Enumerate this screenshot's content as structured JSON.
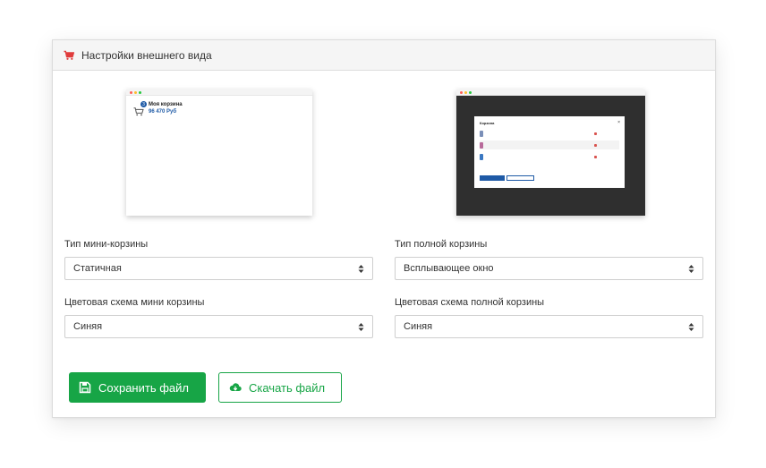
{
  "colors": {
    "accent_green": "#17a546",
    "brand_blue": "#1e5aa6",
    "header_icon_red": "#e03b3b"
  },
  "header": {
    "icon": "shopping-cart-icon",
    "title": "Настройки внешнего вида"
  },
  "preview_mini": {
    "cart_title": "Моя корзина",
    "cart_sum": "96 470 Руб",
    "badge": "3"
  },
  "preview_full": {
    "modal_title": "Корзина",
    "close": "×"
  },
  "form": {
    "mini_type": {
      "label": "Тип мини-корзины",
      "value": "Статичная"
    },
    "full_type": {
      "label": "Тип полной корзины",
      "value": "Всплывающее окно"
    },
    "mini_color": {
      "label": "Цветовая схема мини корзины",
      "value": "Синяя"
    },
    "full_color": {
      "label": "Цветовая схема полной корзины",
      "value": "Синяя"
    }
  },
  "actions": {
    "save": {
      "label": "Сохранить файл",
      "icon": "floppy-disk-icon"
    },
    "download": {
      "label": "Скачать файл",
      "icon": "cloud-download-icon"
    }
  }
}
